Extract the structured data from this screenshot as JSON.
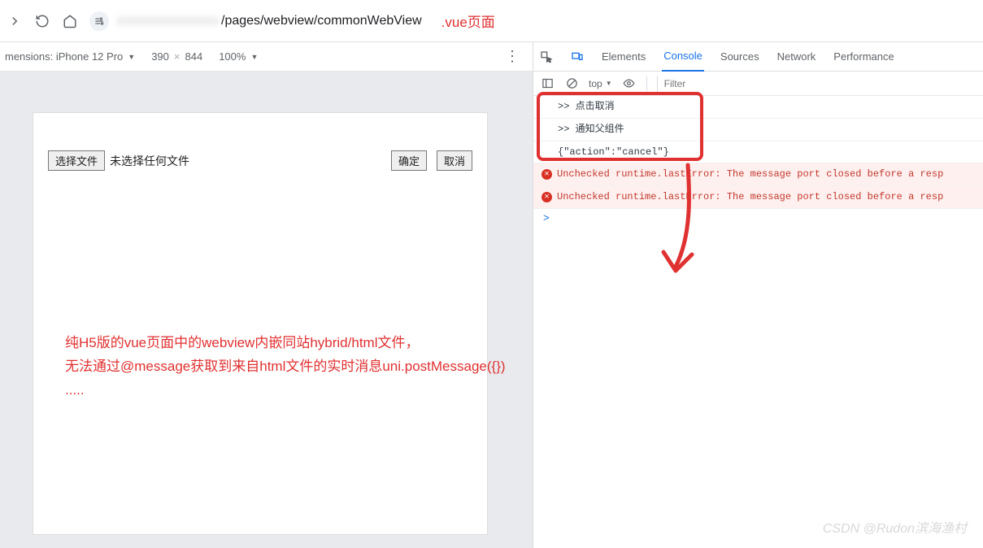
{
  "browser": {
    "url_visible": "/pages/webview/commonWebView",
    "url_hidden": "xxxxxxxxxxxxxx",
    "vue_annotation": ".vue页面"
  },
  "device_bar": {
    "label": "mensions: iPhone 12 Pro",
    "width": "390",
    "height": "844",
    "zoom": "100%"
  },
  "page": {
    "choose_file_btn": "选择文件",
    "no_file_text": "未选择任何文件",
    "confirm_btn": "确定",
    "cancel_btn": "取消"
  },
  "annotation": {
    "line1": "纯H5版的vue页面中的webview内嵌同站hybrid/html文件，",
    "line2": "无法通过@message获取到来自html文件的实时消息uni.postMessage({})",
    "line3": "....."
  },
  "devtools": {
    "tabs": {
      "elements": "Elements",
      "console": "Console",
      "sources": "Sources",
      "network": "Network",
      "performance": "Performance"
    },
    "toolbar": {
      "context": "top",
      "filter_placeholder": "Filter"
    },
    "logs": {
      "l1": ">> 点击取消",
      "l2": ">> 通知父组件",
      "l3": "{\"action\":\"cancel\"}",
      "err1": "Unchecked runtime.lastError: The message port closed before a resp",
      "err2": "Unchecked runtime.lastError: The message port closed before a resp",
      "prompt": ">"
    }
  },
  "watermark": "CSDN @Rudon滨海渔村"
}
